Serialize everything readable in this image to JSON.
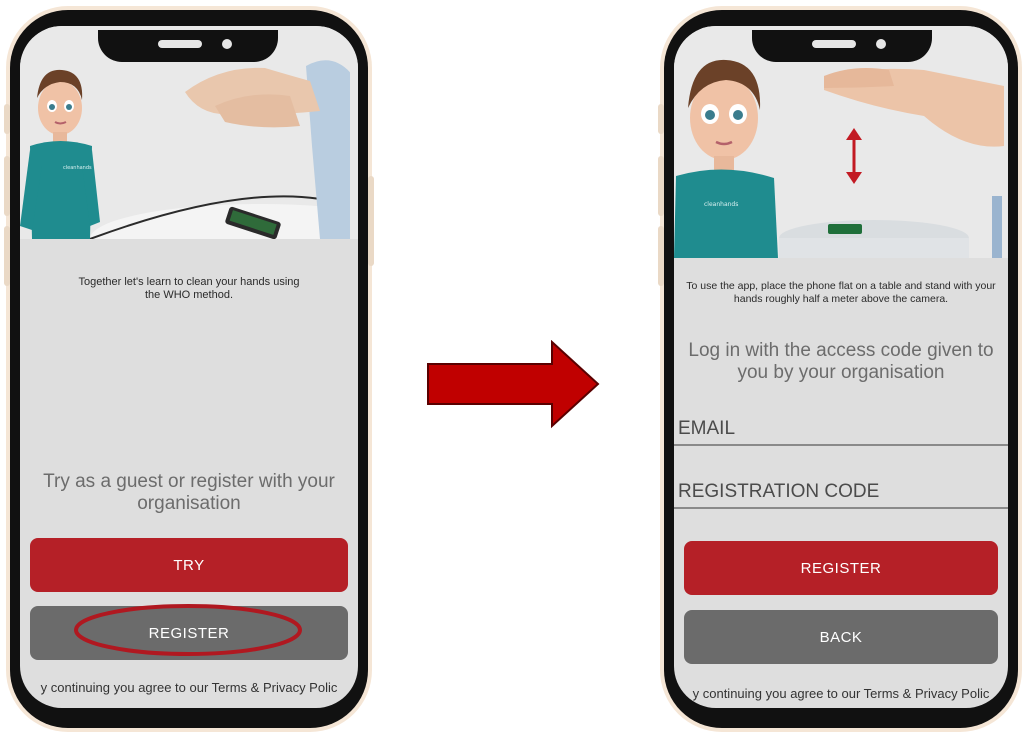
{
  "left_screen": {
    "intro_text": "Together let's learn to clean your hands using the WHO method.",
    "prompt": "Try as a guest or register with your organisation",
    "try_label": "TRY",
    "register_label": "REGISTER",
    "terms": "y continuing you agree to our Terms & Privacy Polic",
    "avatar_shirt_text": "cleanhands"
  },
  "right_screen": {
    "intro_text": "To use the app, place the phone flat on a table and stand with your hands roughly half a meter above the camera.",
    "login_prompt": "Log in with the access code given to you by your organisation",
    "email_placeholder": "EMAIL",
    "registration_code_placeholder": "REGISTRATION CODE",
    "register_label": "REGISTER",
    "back_label": "BACK",
    "terms": "y continuing you agree to our Terms & Privacy Polic",
    "avatar_shirt_text": "cleanhands"
  },
  "colors": {
    "primary_red": "#b52027",
    "secondary_gray": "#6b6b6b",
    "highlight_ellipse": "#b01820",
    "arrow_fill": "#c00000"
  }
}
